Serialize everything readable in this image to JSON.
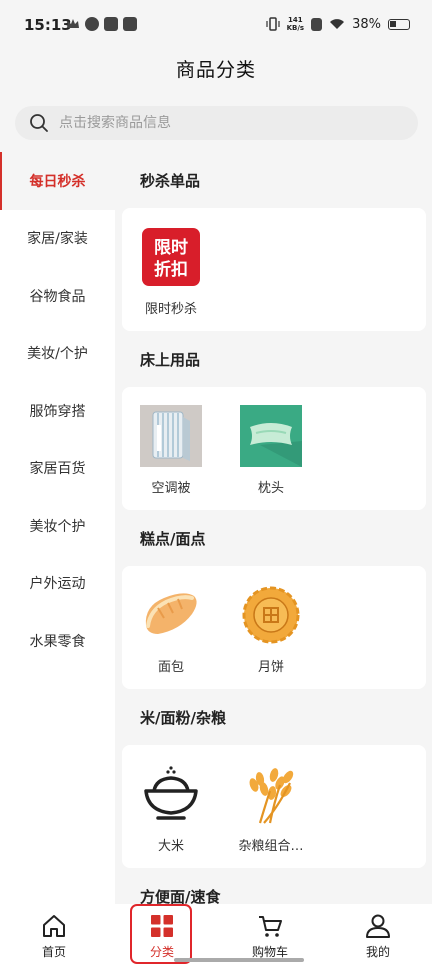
{
  "status_bar": {
    "time": "15:13",
    "net_speed_value": "141",
    "net_speed_unit": "KB/s",
    "battery": "38%"
  },
  "header": {
    "title": "商品分类"
  },
  "search": {
    "placeholder": "点击搜索商品信息"
  },
  "sidebar": {
    "items": [
      {
        "label": "每日秒杀"
      },
      {
        "label": "家居/家装"
      },
      {
        "label": "谷物食品"
      },
      {
        "label": "美妆/个护"
      },
      {
        "label": "服饰穿搭"
      },
      {
        "label": "家居百货"
      },
      {
        "label": "美妆个护"
      },
      {
        "label": "户外运动"
      },
      {
        "label": "水果零食"
      }
    ],
    "active_index": 0
  },
  "sections": [
    {
      "title": "秒杀单品",
      "products": [
        {
          "name": "限时秒杀",
          "icon": "flash-sale-icon",
          "badge_text": "限时折扣"
        }
      ]
    },
    {
      "title": "床上用品",
      "products": [
        {
          "name": "空调被",
          "icon": "quilt-icon"
        },
        {
          "name": "枕头",
          "icon": "pillow-icon"
        }
      ]
    },
    {
      "title": "糕点/面点",
      "products": [
        {
          "name": "面包",
          "icon": "bread-icon"
        },
        {
          "name": "月饼",
          "icon": "mooncake-icon"
        }
      ]
    },
    {
      "title": "米/面粉/杂粮",
      "products": [
        {
          "name": "大米",
          "icon": "rice-bowl-icon"
        },
        {
          "name": "杂粮组合…",
          "icon": "wheat-icon"
        }
      ]
    },
    {
      "title": "方便面/速食",
      "products": []
    }
  ],
  "tabbar": {
    "items": [
      {
        "label": "首页",
        "icon": "home-icon"
      },
      {
        "label": "分类",
        "icon": "category-icon"
      },
      {
        "label": "购物车",
        "icon": "cart-icon"
      },
      {
        "label": "我的",
        "icon": "user-icon"
      }
    ],
    "active_index": 1
  },
  "colors": {
    "accent": "#d4302a",
    "background": "#f5f5f5"
  }
}
